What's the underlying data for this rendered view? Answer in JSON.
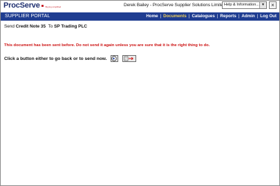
{
  "header": {
    "logo_text": "ProcServe",
    "logo_tagline": "Buying simplified",
    "user_info": "Derek Bailey - ProcServe Supplier Solutions Limited",
    "help_select_value": "Help & Information...",
    "close_label": "×"
  },
  "navbar": {
    "title": "SUPPLIER PORTAL",
    "links": [
      "Home",
      "Documents",
      "Catalogues",
      "Reports",
      "Admin",
      "Log Out"
    ],
    "active": "Documents",
    "separator": "|"
  },
  "main": {
    "send_prefix": "Send",
    "document": "Credit Note 35",
    "to_label": "To",
    "recipient": "SP Trading PLC",
    "warning": "This document has been sent before. Do not send it again unless you are sure that it is the right thing to do.",
    "prompt": "Click a button either to go back or to send now."
  },
  "colors": {
    "nav_background": "#1f3d91",
    "nav_active": "#f3d25a",
    "warning": "#cc1111",
    "logo_blue": "#1f2f6f"
  }
}
